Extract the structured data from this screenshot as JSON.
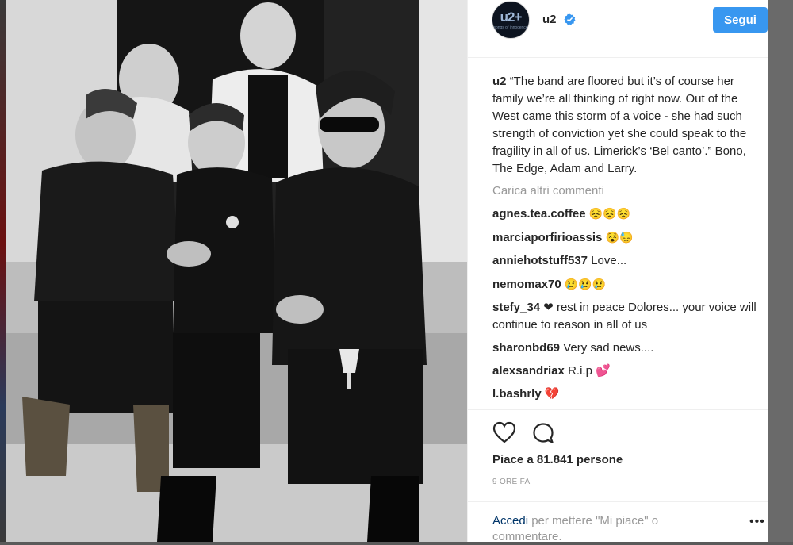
{
  "post": {
    "author": "u2",
    "follow_label": "Segui",
    "avatar_text": "u2+",
    "avatar_sub": "songs of innocence",
    "caption_user": "u2",
    "caption_text": "“The band are floored but it’s of course her family we’re all thinking of right now. Out of the West came this storm of a voice - she had such strength of conviction yet she could speak to the fragility in all of us. Limerick’s ‘Bel canto’.” Bono, The Edge, Adam and Larry.",
    "load_more": "Carica altri commenti",
    "comments": [
      {
        "user": "agnes.tea.coffee",
        "text": "😣😣😣"
      },
      {
        "user": "marciaporfirioassis",
        "text": "😵😓"
      },
      {
        "user": "anniehotstuff537",
        "text": "Love..."
      },
      {
        "user": "nemomax70",
        "text": "😢😢😢"
      },
      {
        "user": "stefy_34",
        "text": "❤ rest in peace Dolores... your voice will continue to reason in all of us"
      },
      {
        "user": "sharonbd69",
        "text": "Very sad news...."
      },
      {
        "user": "alexsandriax",
        "text": "R.i.p 💕"
      },
      {
        "user": "l.bashrly",
        "text": "💔"
      }
    ],
    "likes": "Piace a 81.841 persone",
    "timestamp": "9 ORE FA",
    "login_link": "Accedi",
    "login_text": " per mettere \"Mi piace\" o commentare."
  },
  "colors": {
    "accent": "#3897f0",
    "text": "#262626",
    "muted": "#999999",
    "link": "#003569"
  },
  "icons": [
    "verified-badge-icon",
    "heart-icon",
    "comment-bubble-icon",
    "more-options-icon"
  ]
}
